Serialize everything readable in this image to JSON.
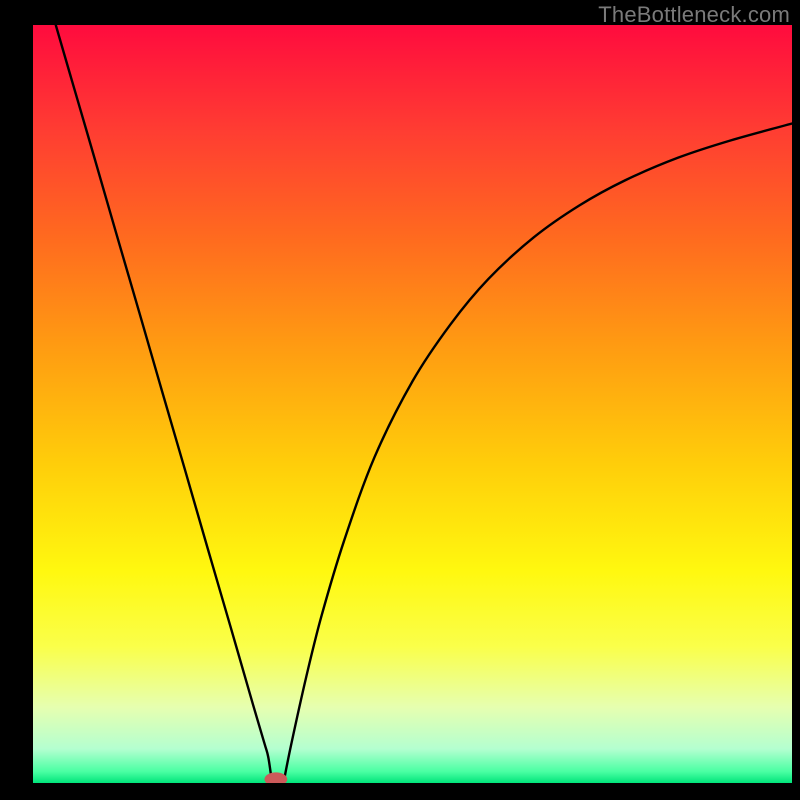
{
  "watermark": "TheBottleneck.com",
  "chart_data": {
    "type": "line",
    "title": "",
    "xlabel": "",
    "ylabel": "",
    "xlim": [
      0,
      100
    ],
    "ylim": [
      0,
      100
    ],
    "grid": false,
    "legend": false,
    "background_gradient": {
      "stops": [
        {
          "offset": 0.0,
          "color": "#ff0b3e"
        },
        {
          "offset": 0.14,
          "color": "#ff3d32"
        },
        {
          "offset": 0.28,
          "color": "#ff6a1f"
        },
        {
          "offset": 0.42,
          "color": "#ff9a12"
        },
        {
          "offset": 0.58,
          "color": "#ffce0a"
        },
        {
          "offset": 0.72,
          "color": "#fff80f"
        },
        {
          "offset": 0.82,
          "color": "#faff4a"
        },
        {
          "offset": 0.9,
          "color": "#e6ffb0"
        },
        {
          "offset": 0.955,
          "color": "#b4ffd0"
        },
        {
          "offset": 0.985,
          "color": "#4affa3"
        },
        {
          "offset": 1.0,
          "color": "#00e47a"
        }
      ]
    },
    "series": [
      {
        "name": "left-branch",
        "x": [
          3.0,
          5.0,
          8.0,
          11.0,
          14.0,
          17.0,
          20.0,
          23.0,
          26.0,
          29.0,
          30.5,
          31.0,
          31.5
        ],
        "values": [
          100.0,
          93.1,
          82.8,
          72.4,
          62.1,
          51.7,
          41.4,
          31.0,
          20.7,
          10.3,
          5.2,
          3.4,
          0.0
        ]
      },
      {
        "name": "right-branch",
        "x": [
          33.0,
          34.0,
          36.0,
          38.0,
          41.0,
          45.0,
          50.0,
          55.0,
          60.0,
          66.0,
          72.0,
          78.0,
          85.0,
          92.0,
          100.0
        ],
        "values": [
          0.0,
          5.0,
          14.0,
          22.0,
          32.0,
          43.0,
          53.0,
          60.5,
          66.5,
          72.0,
          76.2,
          79.5,
          82.5,
          84.8,
          87.0
        ]
      }
    ],
    "marker": {
      "name": "bottleneck-marker",
      "x": 32.0,
      "y": 0.5,
      "rx": 1.5,
      "ry": 0.9,
      "color": "#cc5a5a"
    }
  }
}
